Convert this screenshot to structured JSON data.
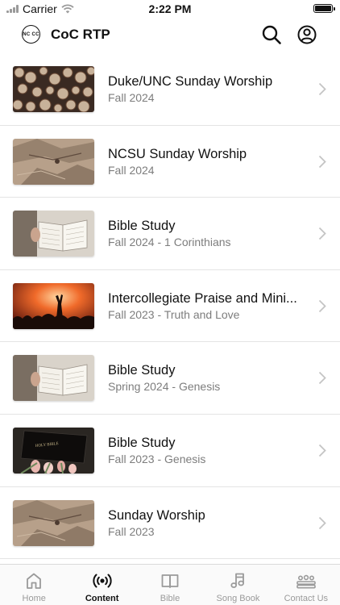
{
  "status_bar": {
    "carrier": "Carrier",
    "time": "2:22 PM"
  },
  "header": {
    "logo_text": "NC CC",
    "title": "CoC RTP"
  },
  "list": [
    {
      "title": "Duke/UNC Sunday Worship",
      "subtitle": "Fall 2024",
      "thumbnail": "log-pile-image"
    },
    {
      "title": "NCSU Sunday Worship",
      "subtitle": "Fall 2024",
      "thumbnail": "field-map-image"
    },
    {
      "title": "Bible Study",
      "subtitle": "Fall 2024 - 1 Corinthians",
      "thumbnail": "open-bible-image"
    },
    {
      "title": "Intercollegiate Praise and Mini...",
      "subtitle": "Fall 2023 - Truth and Love",
      "thumbnail": "worship-crowd-image"
    },
    {
      "title": "Bible Study",
      "subtitle": "Spring 2024 - Genesis",
      "thumbnail": "open-bible-image"
    },
    {
      "title": "Bible Study",
      "subtitle": "Fall 2023 - Genesis",
      "thumbnail": "holy-bible-tulips-image"
    },
    {
      "title": "Sunday Worship",
      "subtitle": "Fall 2023",
      "thumbnail": "field-map-image"
    }
  ],
  "tabs": [
    {
      "label": "Home",
      "icon": "home-icon",
      "active": false
    },
    {
      "label": "Content",
      "icon": "broadcast-icon",
      "active": true
    },
    {
      "label": "Bible",
      "icon": "book-icon",
      "active": false
    },
    {
      "label": "Song Book",
      "icon": "music-note-icon",
      "active": false
    },
    {
      "label": "Contact Us",
      "icon": "people-group-icon",
      "active": false
    }
  ],
  "colors": {
    "text": "#111111",
    "subtle": "#7d7d7d",
    "inactive_tab": "#9a9a9a",
    "separator": "#e4e4e4"
  }
}
